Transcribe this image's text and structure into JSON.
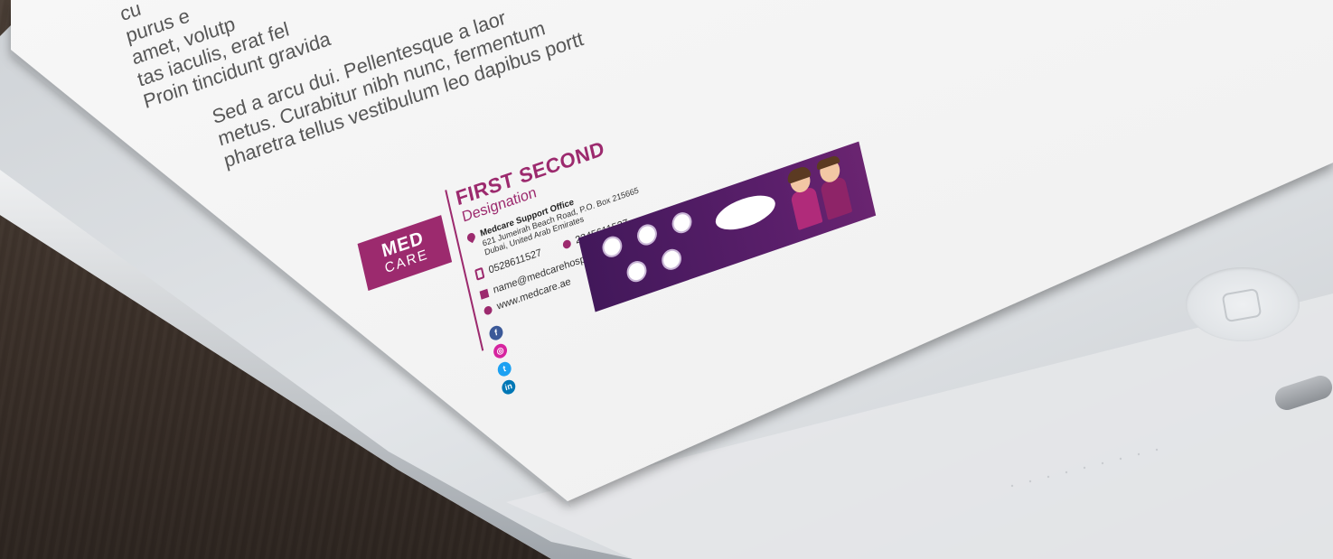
{
  "document": {
    "paragraphs": [
      [
        "cu",
        "purus e",
        "amet, volutp",
        "tas iaculis, erat fel",
        "Proin tincidunt gravida"
      ],
      [
        "Sed a arcu dui. Pellentesque a laor",
        "metus. Curabitur nibh nunc, fermentum",
        "pharetra tellus vestibulum leo dapibus portt"
      ]
    ]
  },
  "signature": {
    "logo": {
      "line1": "MED",
      "line2": "CARE"
    },
    "name": "FIRST SECOND",
    "designation": "Designation",
    "office": {
      "title": "Medcare Support Office",
      "address1": "621 Jumeirah Beach Road, P.O. Box 215665",
      "address2": "Dubai, United Arab Emirates"
    },
    "mobile": "0528611527",
    "phone": "2345611527",
    "email": "name@medcarehospital.com",
    "website": "www.medcare.ae",
    "social": [
      {
        "icon": "facebook-icon",
        "glyph": "f",
        "color": "#3b5998"
      },
      {
        "icon": "instagram-icon",
        "glyph": "◎",
        "color": "#d6249f"
      },
      {
        "icon": "twitter-icon",
        "glyph": "t",
        "color": "#1da1f2"
      },
      {
        "icon": "linkedin-icon",
        "glyph": "in",
        "color": "#0077b5"
      }
    ],
    "banner": {
      "colors": {
        "bg": "#4a1a5e"
      }
    }
  },
  "colors": {
    "brand": "#9c2a6e",
    "paper": "#f4f4f4",
    "tablet_frame": "#dcdfe2",
    "table_wood": "#3b3029"
  }
}
